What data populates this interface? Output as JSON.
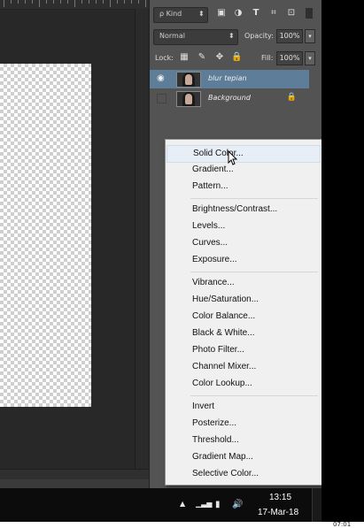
{
  "panel": {
    "kind_filter": "ρ Kind",
    "blend_mode": "Normal",
    "opacity_label": "Opacity:",
    "opacity_value": "100%",
    "lock_label": "Lock:",
    "fill_label": "Fill:",
    "fill_value": "100%",
    "layers": [
      {
        "name": "blur tepian",
        "selected": true,
        "visible": true
      },
      {
        "name": "Background",
        "selected": false,
        "visible": false,
        "locked": true
      }
    ],
    "filter_icons": [
      "image-icon",
      "circle-half-icon",
      "type-icon",
      "transform-icon",
      "smart-object-icon"
    ]
  },
  "adjustment_menu": {
    "groups": [
      [
        "Solid Color...",
        "Gradient...",
        "Pattern..."
      ],
      [
        "Brightness/Contrast...",
        "Levels...",
        "Curves...",
        "Exposure..."
      ],
      [
        "Vibrance...",
        "Hue/Saturation...",
        "Color Balance...",
        "Black & White...",
        "Photo Filter...",
        "Channel Mixer...",
        "Color Lookup..."
      ],
      [
        "Invert",
        "Posterize...",
        "Threshold...",
        "Gradient Map...",
        "Selective Color..."
      ]
    ],
    "highlighted": "Solid Color..."
  },
  "taskbar": {
    "time": "13:15",
    "date": "17-Mar-18",
    "tray_icons": [
      "show-hidden-icons-icon",
      "network-signal-icon",
      "battery-icon",
      "volume-icon"
    ]
  },
  "corner_text": "07:01"
}
